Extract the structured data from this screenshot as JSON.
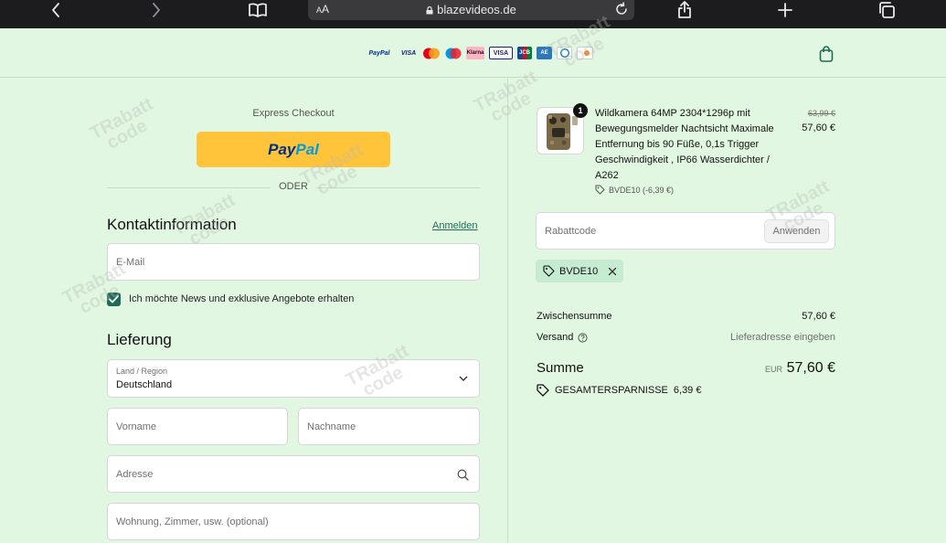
{
  "browser": {
    "text_size_label": "AA",
    "url": "blazevideos.de"
  },
  "header": {
    "payment_methods": [
      "PayPal",
      "VISA",
      "Mastercard",
      "Maestro",
      "Klarna",
      "VISA Electron",
      "JCB",
      "American Express",
      "Diners Club",
      "Discover"
    ]
  },
  "checkout": {
    "express_label": "Express Checkout",
    "paypal_part1": "Pay",
    "paypal_part2": "Pal",
    "or_label": "ODER",
    "contact_title": "Kontaktinformation",
    "login_link": "Anmelden",
    "email_placeholder": "E-Mail",
    "newsletter_label": "Ich möchte News und exklusive Angebote erhalten",
    "newsletter_checked": true,
    "delivery_title": "Lieferung",
    "country_label": "Land / Region",
    "country_value": "Deutschland",
    "firstname_placeholder": "Vorname",
    "lastname_placeholder": "Nachname",
    "address_placeholder": "Adresse",
    "apartment_placeholder": "Wohnung, Zimmer, usw. (optional)"
  },
  "order": {
    "quantity": "1",
    "product_name": "Wildkamera 64MP 2304*1296p mit Bewegungsmelder Nachtsicht Maximale Entfernung bis 90 Füße, 0,1s Trigger Geschwindigkeit , IP66 Wasserdichter / A262",
    "product_discount": "BVDE10 (-6,39 €)",
    "original_price": "63,99 €",
    "price": "57,60 €",
    "coupon_placeholder": "Rabattcode",
    "apply_label": "Anwenden",
    "applied_code": "BVDE10",
    "subtotal_label": "Zwischensumme",
    "subtotal_value": "57,60 €",
    "shipping_label": "Versand",
    "shipping_value": "Lieferadresse eingeben",
    "total_label": "Summe",
    "currency": "EUR",
    "total_value": "57,60 €",
    "savings_label": "GESAMTERSPARNISSE",
    "savings_value": "6,39 €"
  },
  "colors": {
    "background": "#e2f7e2",
    "accent": "#1f6b55",
    "paypal_yellow": "#ffc439",
    "tag_bg": "#c5ebd0"
  }
}
